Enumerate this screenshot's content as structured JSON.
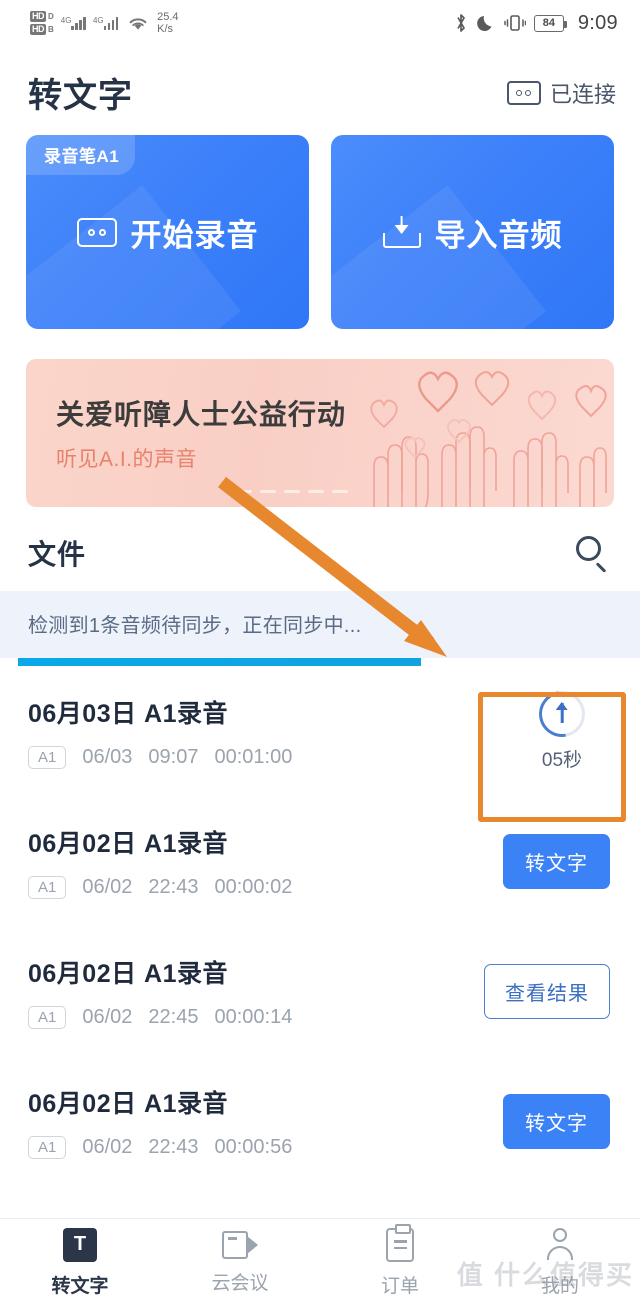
{
  "status_bar": {
    "hd_label": "HD",
    "network_type": "4G",
    "speed_value": "25.4",
    "speed_unit": "K/s",
    "battery": "84",
    "time": "9:09",
    "icons": [
      "hd-volte-icon",
      "signal-bars-icon",
      "wifi-icon",
      "bluetooth-icon",
      "do-not-disturb-icon",
      "vibrate-icon",
      "battery-icon"
    ]
  },
  "header": {
    "title": "转文字",
    "connection_status": "已连接",
    "connection_icon": "recorder-icon"
  },
  "action_cards": [
    {
      "badge": "录音笔A1",
      "label": "开始录音",
      "icon": "cassette-icon",
      "color": "#3d80fa"
    },
    {
      "badge": "",
      "label": "导入音频",
      "icon": "import-audio-icon",
      "color": "#3d80fa"
    }
  ],
  "banner": {
    "title": "关爱听障人士公益行动",
    "subtitle": "听见A.I.的声音",
    "bg_color": "#f9cfc5",
    "subtitle_color": "#e8826e"
  },
  "files": {
    "section_title": "文件",
    "search_icon": "search-icon",
    "sync_message": "检测到1条音频待同步，正在同步中...",
    "sync_progress_percent": 63,
    "sync_bar_color": "#0fa3e0",
    "rows": [
      {
        "title": "06月03日 A1录音",
        "tag": "A1",
        "date": "06/03",
        "time": "09:07",
        "duration": "00:01:00",
        "action_type": "uploading",
        "action_label": "05秒",
        "highlighted": true
      },
      {
        "title": "06月02日 A1录音",
        "tag": "A1",
        "date": "06/02",
        "time": "22:43",
        "duration": "00:00:02",
        "action_type": "primary",
        "action_label": "转文字",
        "highlighted": false
      },
      {
        "title": "06月02日 A1录音",
        "tag": "A1",
        "date": "06/02",
        "time": "22:45",
        "duration": "00:00:14",
        "action_type": "outline",
        "action_label": "查看结果",
        "highlighted": false
      },
      {
        "title": "06月02日 A1录音",
        "tag": "A1",
        "date": "06/02",
        "time": "22:43",
        "duration": "00:00:56",
        "action_type": "primary",
        "action_label": "转文字",
        "highlighted": false
      }
    ]
  },
  "tab_bar": {
    "items": [
      {
        "label": "转文字",
        "icon": "text-convert-icon",
        "active": true
      },
      {
        "label": "云会议",
        "icon": "video-meeting-icon",
        "active": false
      },
      {
        "label": "订单",
        "icon": "order-clipboard-icon",
        "active": false
      },
      {
        "label": "我的",
        "icon": "user-profile-icon",
        "active": false
      }
    ]
  },
  "annotations": {
    "arrow_color": "#e8882e",
    "box_color": "#e8882e"
  },
  "watermark": "值 什么值得买"
}
